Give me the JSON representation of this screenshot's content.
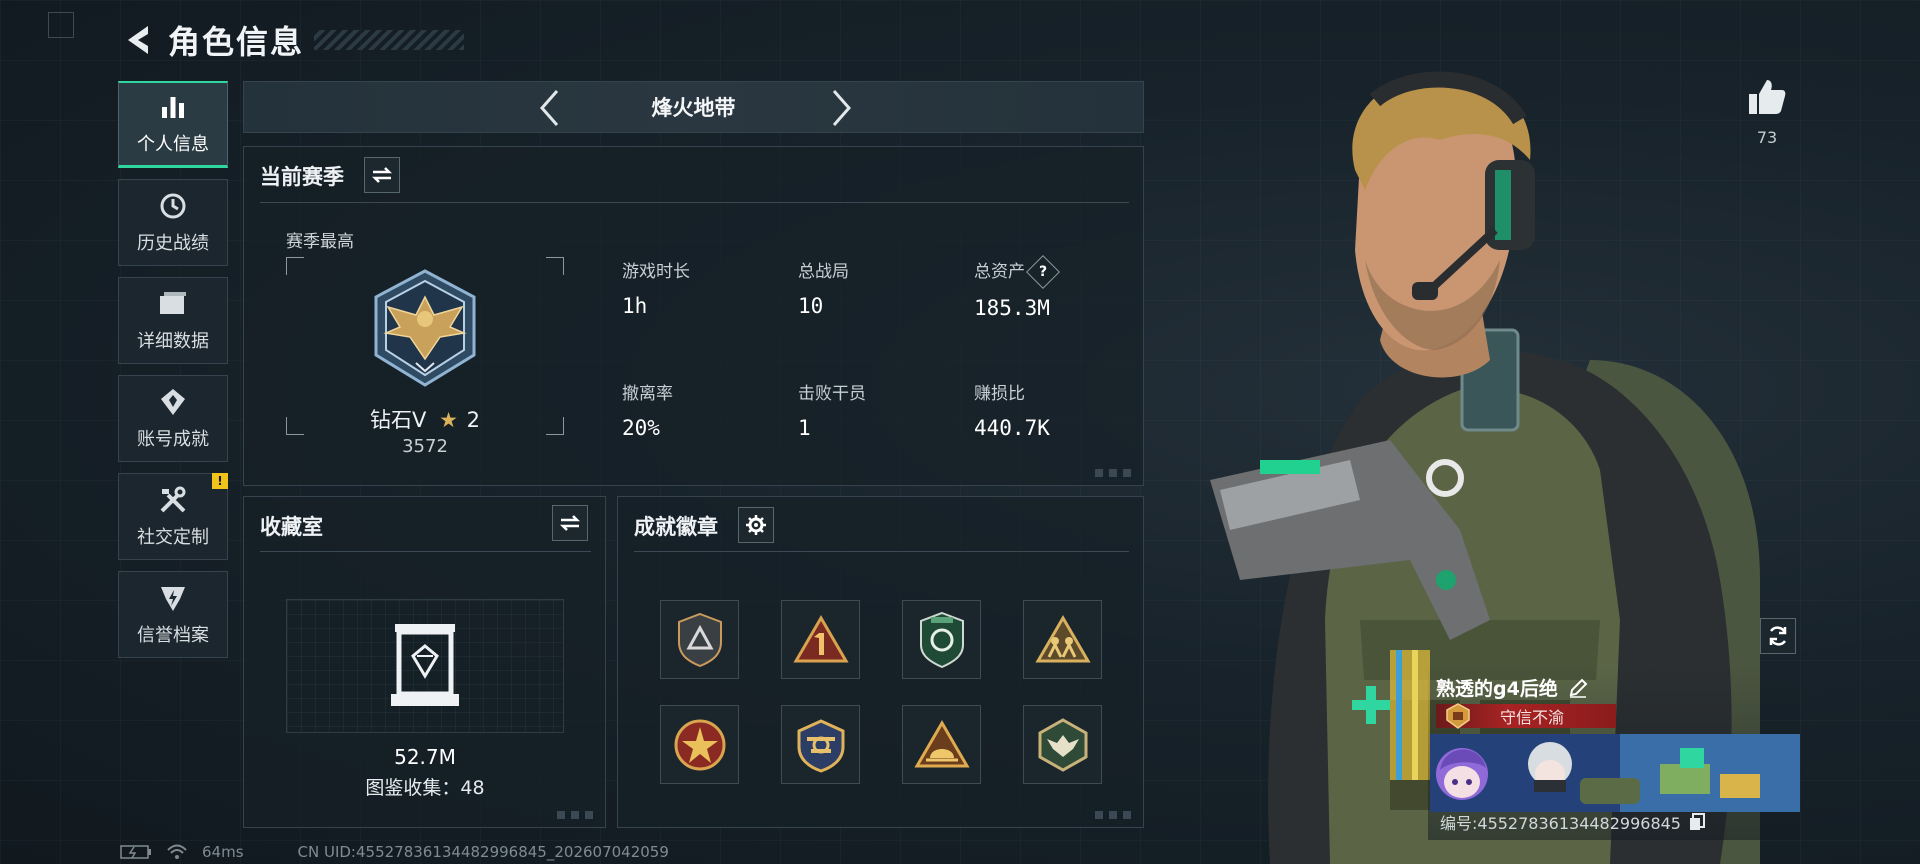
{
  "header": {
    "title": "角色信息"
  },
  "sidebar": {
    "items": [
      {
        "label": "个人信息",
        "icon": "bar-chart-icon"
      },
      {
        "label": "历史战绩",
        "icon": "history-clock-icon"
      },
      {
        "label": "详细数据",
        "icon": "folder-icon"
      },
      {
        "label": "账号成就",
        "icon": "achievement-icon"
      },
      {
        "label": "社交定制",
        "icon": "tools-icon",
        "badge": "!"
      },
      {
        "label": "信誉档案",
        "icon": "shield-lightning-icon"
      }
    ]
  },
  "mode": {
    "title": "烽火地带"
  },
  "season": {
    "title": "当前赛季",
    "best_label": "赛季最高",
    "rank_name": "钻石V",
    "rank_stars": "2",
    "rank_score": "3572",
    "stats": [
      {
        "label": "游戏时长",
        "value": "1h"
      },
      {
        "label": "总战局",
        "value": "10"
      },
      {
        "label": "总资产",
        "value": "185.3M",
        "help": "?"
      },
      {
        "label": "撤离率",
        "value": "20%"
      },
      {
        "label": "击败干员",
        "value": "1"
      },
      {
        "label": "赚损比",
        "value": "440.7K"
      }
    ]
  },
  "collection": {
    "title": "收藏室",
    "value": "52.7M",
    "count_text": "图鉴收集：48"
  },
  "badges": {
    "title": "成就徽章",
    "items": [
      "badge-shield-icon",
      "badge-triangle-one-icon",
      "badge-green-emblem-icon",
      "badge-soldiers-icon",
      "badge-star-medal-icon",
      "badge-crest-icon",
      "badge-helmet-triangle-icon",
      "badge-eagle-hex-icon"
    ]
  },
  "likes": {
    "count": "73"
  },
  "player": {
    "name": "熟透的g4后绝",
    "title": "守信不渝",
    "uid_text": "编号:455278361344829968​45"
  },
  "status": {
    "ping": "64ms",
    "uid": "CN UID:455278361344829968​45_202607042059"
  },
  "colors": {
    "accent": "#2fd6a0",
    "title_red": "#a82323",
    "warn": "#f0c419"
  }
}
